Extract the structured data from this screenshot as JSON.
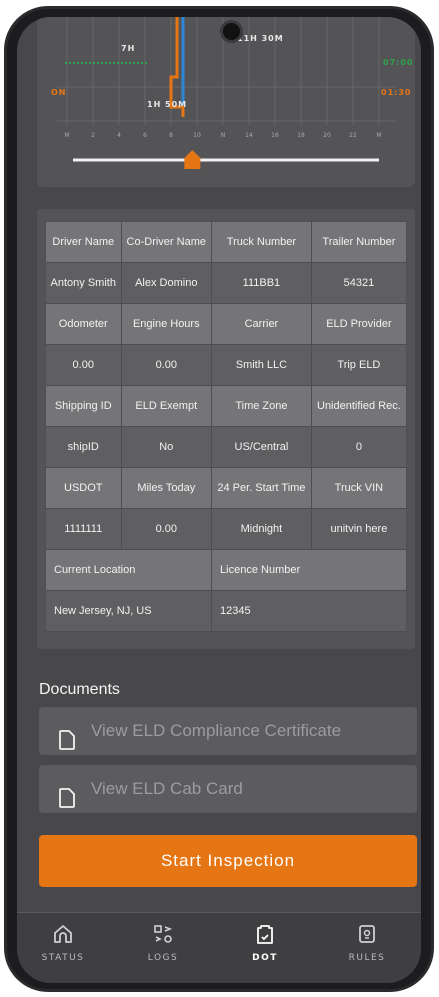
{
  "graph": {
    "top_label_left": "7H",
    "top_label_right": "11H 30M",
    "left_duty": "ON",
    "mid_label": "1H 50M",
    "right_top": "07:00",
    "right_on": "01:30",
    "hours": [
      "M",
      "2",
      "4",
      "6",
      "8",
      "10",
      "N",
      "14",
      "16",
      "18",
      "20",
      "22",
      "M"
    ],
    "slider_level": 0.39,
    "colors": {
      "green": "#2fa34a",
      "orange": "#e67514",
      "blue": "#2f86d6"
    }
  },
  "table": {
    "row1": [
      "Driver Name",
      "Co-Driver Name",
      "Truck Number",
      "Trailer Number"
    ],
    "row2": [
      "Antony Smith",
      "Alex Domino",
      "111BB1",
      "54321"
    ],
    "row3": [
      "Odometer",
      "Engine Hours",
      "Carrier",
      "ELD Provider"
    ],
    "row4": [
      "0.00",
      "0.00",
      "Smith LLC",
      "Trip ELD"
    ],
    "row5": [
      "Shipping ID",
      "ELD Exempt",
      "Time Zone",
      "Unidentified Rec."
    ],
    "row6": [
      "shipID",
      "No",
      "US/Central",
      "0"
    ],
    "row7": [
      "USDOT",
      "Miles Today",
      "24 Per. Start Time",
      "Truck VIN"
    ],
    "row8": [
      "1111111",
      "0.00",
      "Midnight",
      "unitvin here"
    ],
    "row9": [
      "Current Location",
      "Licence Number"
    ],
    "row10": [
      "New Jersey, NJ, US",
      "12345"
    ]
  },
  "documents": {
    "title": "Documents",
    "compliance": "View ELD Compliance Certificate",
    "cab_card": "View ELD Cab Card"
  },
  "start_inspection": "Start Inspection",
  "tabs": [
    {
      "label": "STATUS",
      "icon": "home-icon"
    },
    {
      "label": "LOGS",
      "icon": "logs-icon"
    },
    {
      "label": "DOT",
      "icon": "dot-clipboard-icon"
    },
    {
      "label": "RULES",
      "icon": "rules-icon"
    }
  ]
}
